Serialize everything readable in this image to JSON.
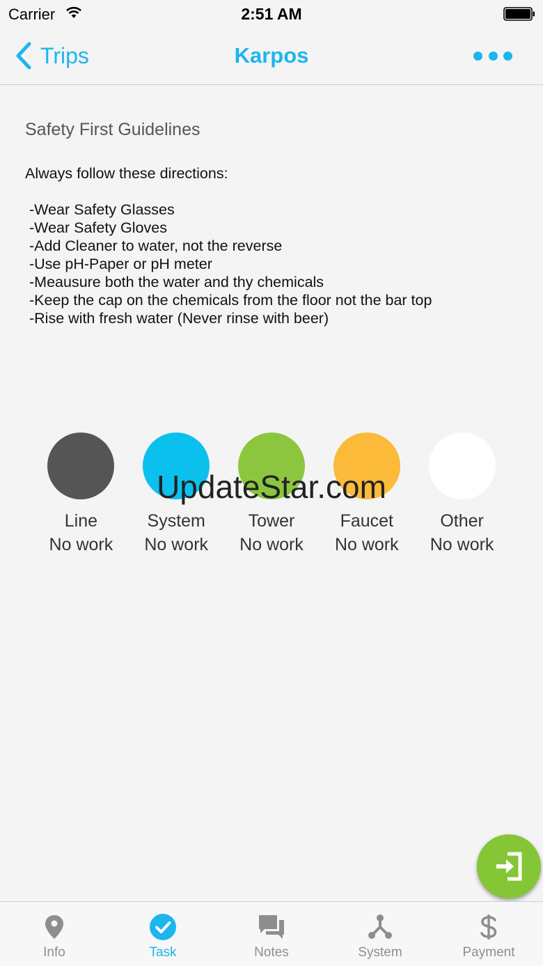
{
  "status_bar": {
    "carrier": "Carrier",
    "time": "2:51 AM"
  },
  "nav": {
    "back_label": "Trips",
    "title": "Karpos"
  },
  "guidelines": {
    "title": "Safety First Guidelines",
    "intro": "Always follow these directions:",
    "items": [
      "-Wear Safety Glasses",
      "-Wear Safety Gloves",
      "-Add Cleaner to water, not the reverse",
      "-Use pH-Paper or pH meter",
      "-Meausure both the water and thy chemicals",
      "-Keep the cap on the chemicals from the floor not the bar top",
      "-Rise with fresh water (Never rinse with beer)"
    ]
  },
  "categories": [
    {
      "name": "Line",
      "status": "No work",
      "color": "#555555"
    },
    {
      "name": "System",
      "status": "No work",
      "color": "#0cc0ee"
    },
    {
      "name": "Tower",
      "status": "No work",
      "color": "#8cc63f"
    },
    {
      "name": "Faucet",
      "status": "No work",
      "color": "#fbba3a"
    },
    {
      "name": "Other",
      "status": "No work",
      "color": "#ffffff"
    }
  ],
  "watermark": "UpdateStar.com",
  "fab": {
    "icon": "sign-in-icon",
    "color": "#84c635"
  },
  "tabs": [
    {
      "label": "Info",
      "icon": "map-pin-icon",
      "active": false
    },
    {
      "label": "Task",
      "icon": "check-circle-icon",
      "active": true
    },
    {
      "label": "Notes",
      "icon": "chat-bubbles-icon",
      "active": false
    },
    {
      "label": "System",
      "icon": "network-icon",
      "active": false
    },
    {
      "label": "Payment",
      "icon": "dollar-icon",
      "active": false
    }
  ],
  "colors": {
    "accent": "#1bb6ee",
    "tab_inactive": "#8e8e8e"
  }
}
